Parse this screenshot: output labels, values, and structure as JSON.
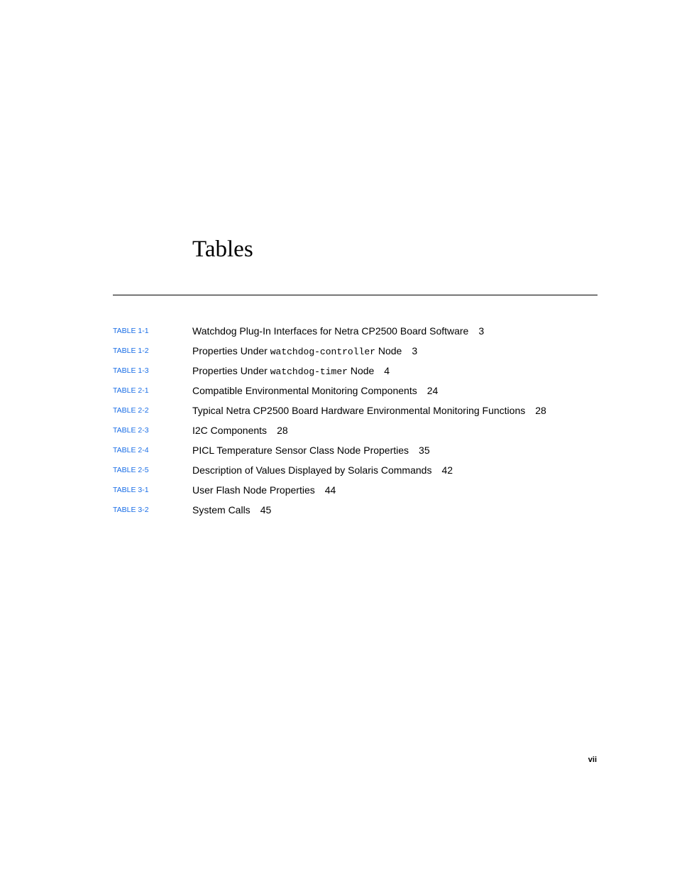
{
  "page": {
    "title": "Tables",
    "folio": "vii"
  },
  "colors": {
    "link": "#1a6ee6",
    "text": "#000000"
  },
  "entries": [
    {
      "ref": "TABLE 1-1",
      "before": "Watchdog Plug-In Interfaces for Netra CP2500 Board Software",
      "code": "",
      "after": "",
      "page": "3"
    },
    {
      "ref": "TABLE 1-2",
      "before": "Properties Under ",
      "code": "watchdog-controller",
      "after": " Node",
      "page": "3"
    },
    {
      "ref": "TABLE 1-3",
      "before": "Properties Under ",
      "code": "watchdog-timer",
      "after": " Node",
      "page": "4"
    },
    {
      "ref": "TABLE 2-1",
      "before": "Compatible Environmental Monitoring Components",
      "code": "",
      "after": "",
      "page": "24"
    },
    {
      "ref": "TABLE 2-2",
      "before": "Typical Netra CP2500 Board Hardware Environmental Monitoring Functions",
      "code": "",
      "after": "",
      "page": "28"
    },
    {
      "ref": "TABLE 2-3",
      "before": "I2C Components",
      "code": "",
      "after": "",
      "page": "28"
    },
    {
      "ref": "TABLE 2-4",
      "before": "PICL Temperature Sensor Class Node Properties",
      "code": "",
      "after": "",
      "page": "35"
    },
    {
      "ref": "TABLE 2-5",
      "before": "Description of Values Displayed by Solaris Commands",
      "code": "",
      "after": "",
      "page": "42"
    },
    {
      "ref": "TABLE 3-1",
      "before": "User Flash Node Properties",
      "code": "",
      "after": "",
      "page": "44"
    },
    {
      "ref": "TABLE 3-2",
      "before": "System Calls",
      "code": "",
      "after": "",
      "page": "45"
    }
  ]
}
